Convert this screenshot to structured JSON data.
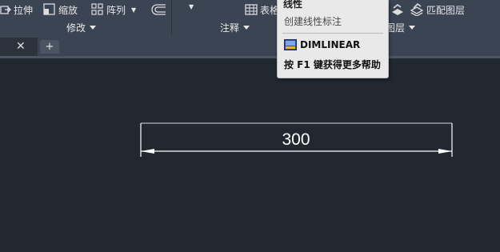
{
  "ribbon": {
    "modify_panel": {
      "stretch_label": "拉伸",
      "scale_label": "缩放",
      "array_label": "阵列",
      "title": "修改"
    },
    "annotation_panel": {
      "table_label": "表格",
      "title": "注释"
    },
    "layers_panel": {
      "match_layer_label": "匹配图层",
      "title": "图层"
    }
  },
  "tooltip": {
    "title": "线性",
    "description": "创建线性标注",
    "command": "DIMLINEAR",
    "help": "按 F1 键获得更多帮助"
  },
  "tabs": {
    "close_glyph": "✕",
    "add_glyph": "+"
  },
  "drawing": {
    "dimension_value": "300"
  },
  "colors": {
    "canvas": "#212830",
    "ribbon": "#3b4453",
    "tooltip_bg": "#e9e9e9",
    "dimension": "#ffffff"
  }
}
